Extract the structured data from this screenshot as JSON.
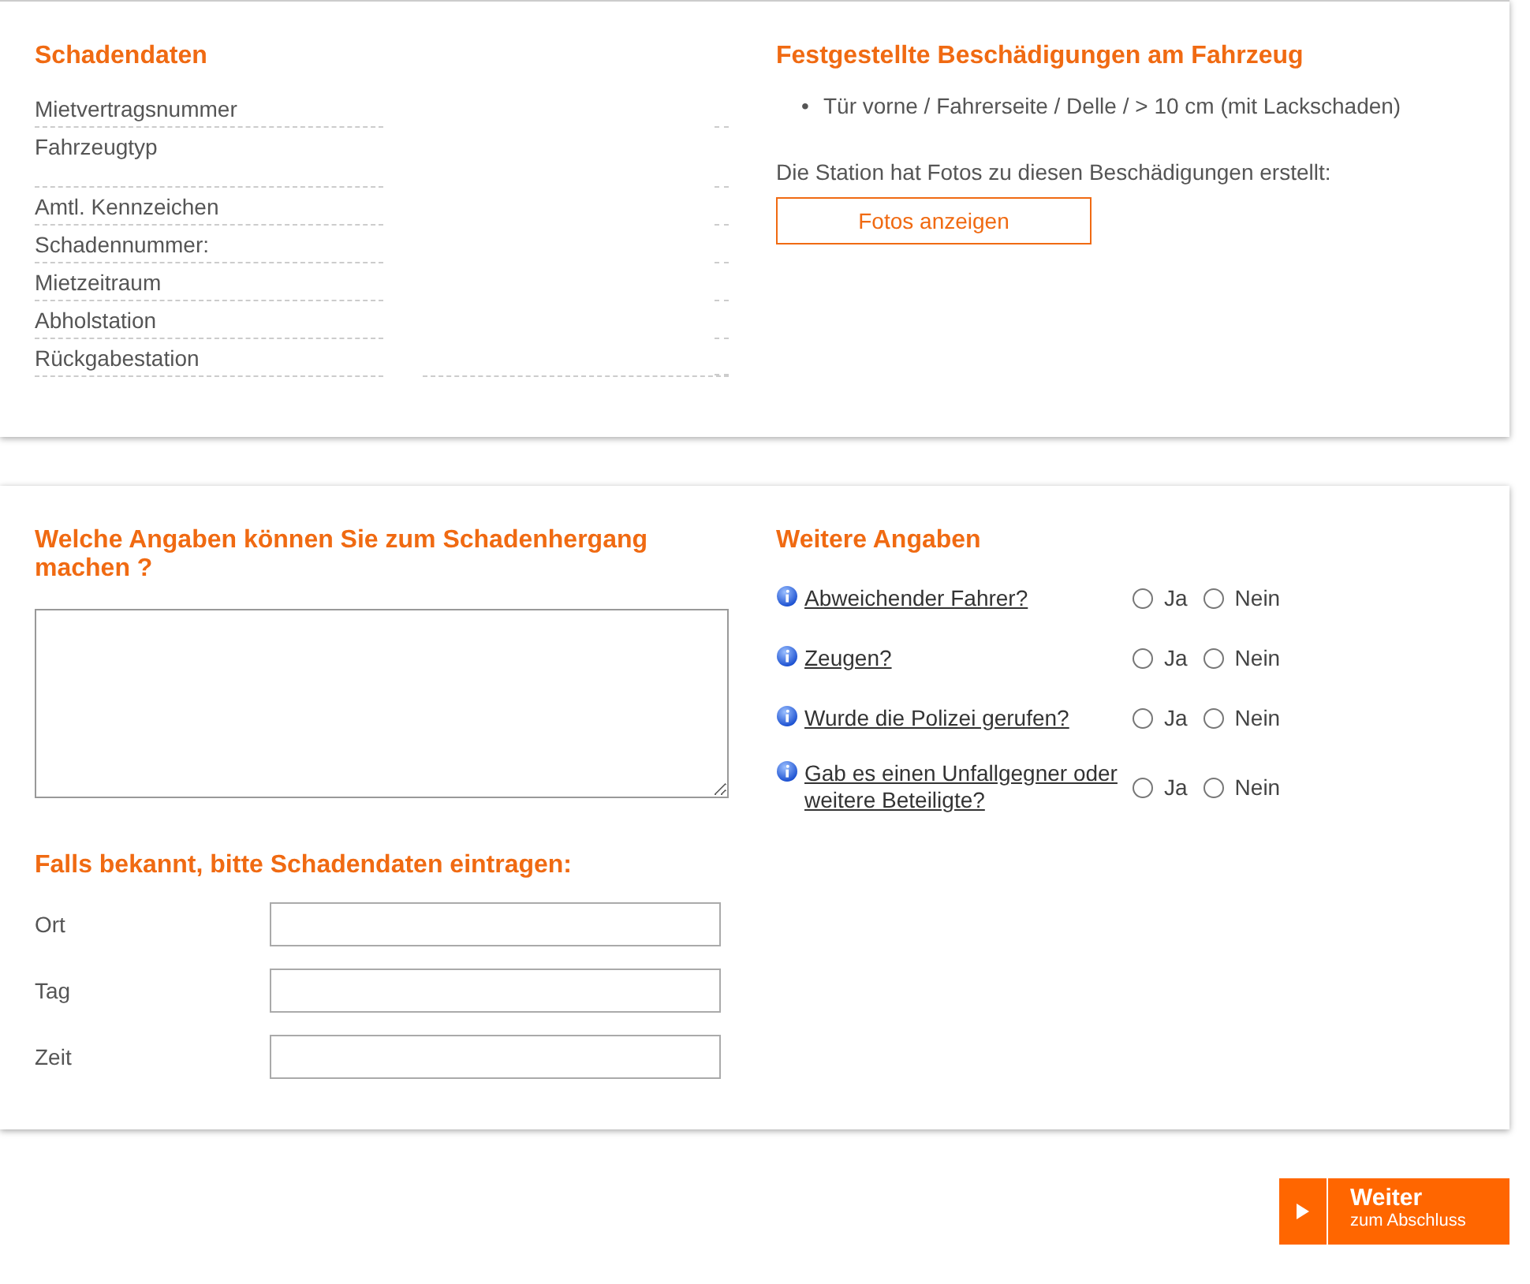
{
  "damage_data": {
    "title": "Schadendaten",
    "rows": [
      {
        "label": "Mietvertragsnummer",
        "tall": false
      },
      {
        "label": "Fahrzeugtyp",
        "tall": true
      },
      {
        "label": "Amtl. Kennzeichen",
        "tall": false
      },
      {
        "label": "Schadennummer:",
        "tall": false
      },
      {
        "label": "Mietzeitraum",
        "tall": false
      },
      {
        "label": "Abholstation",
        "tall": false
      },
      {
        "label": "Rückgabestation",
        "tall": false
      }
    ]
  },
  "damages": {
    "title": "Festgestellte Beschädigungen am Fahrzeug",
    "items": [
      {
        "marker": "•",
        "text": "Tür vorne / Fahrerseite / Delle / > 10 cm (mit Lackschaden)"
      }
    ],
    "photo_note": "Die Station hat Fotos zu diesen Beschädigungen erstellt:",
    "photo_button": "Fotos anzeigen"
  },
  "incident": {
    "title": "Welche Angaben können Sie zum Schadenhergang machen ?",
    "details_title": "Falls bekannt, bitte Schadendaten eintragen:",
    "fields": [
      {
        "label": "Ort"
      },
      {
        "label": "Tag"
      },
      {
        "label": "Zeit"
      }
    ]
  },
  "further": {
    "title": "Weitere Angaben",
    "questions": [
      {
        "text": "Abweichender Fahrer?",
        "options": [
          {
            "label": "Ja",
            "selected": false
          },
          {
            "label": "Nein",
            "selected": false
          }
        ]
      },
      {
        "text": "Zeugen?",
        "options": [
          {
            "label": "Ja",
            "selected": false
          },
          {
            "label": "Nein",
            "selected": false
          }
        ]
      },
      {
        "text": "Wurde die Polizei gerufen?",
        "options": [
          {
            "label": "Ja",
            "selected": false
          },
          {
            "label": "Nein",
            "selected": false
          }
        ]
      },
      {
        "text": "Gab es einen Unfallgegner oder weitere Beteiligte?",
        "options": [
          {
            "label": "Ja",
            "selected": false
          },
          {
            "label": "Nein",
            "selected": false
          }
        ]
      }
    ]
  },
  "next_button": {
    "title": "Weiter",
    "subtitle": "zum Abschluss"
  }
}
